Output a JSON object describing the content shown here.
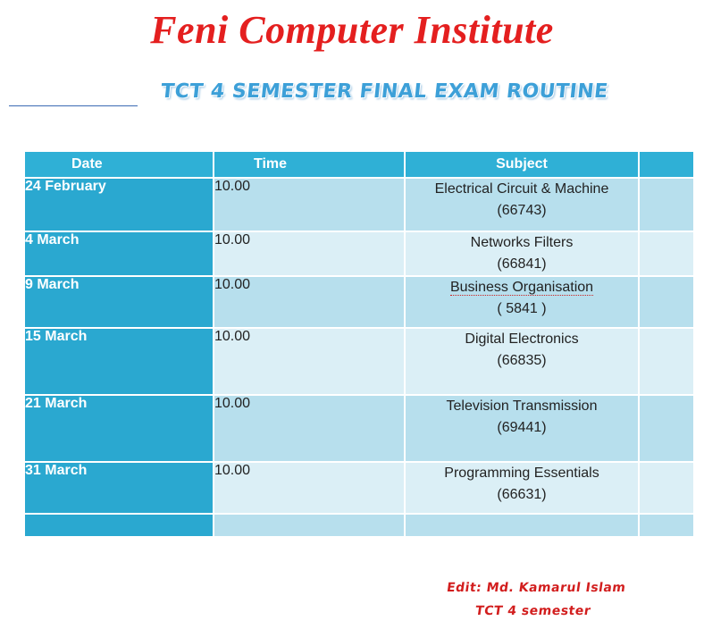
{
  "header": {
    "title": "Feni Computer Institute",
    "subtitle": "TCT 4 SEMESTER FINAL EXAM ROUTINE"
  },
  "table": {
    "columns": [
      "Date",
      "Time",
      "Subject"
    ],
    "rows": [
      {
        "date": "24 February",
        "time": "10.00",
        "subject": "Electrical Circuit & Machine",
        "code": "(66743)"
      },
      {
        "date": "4 March",
        "time": "10.00",
        "subject": "Networks  Filters",
        "code": "(66841)"
      },
      {
        "date": "9 March",
        "time": "10.00",
        "subject": "Business  Organisation",
        "code": "( 5841 )"
      },
      {
        "date": "15 March",
        "time": "10.00",
        "subject": "Digital  Electronics",
        "code": "(66835)"
      },
      {
        "date": "21 March",
        "time": "10.00",
        "subject": "Television Transmission",
        "code": "(69441)"
      },
      {
        "date": "31 March",
        "time": "10.00",
        "subject": "Programming  Essentials",
        "code": "(66631)"
      }
    ]
  },
  "signature": {
    "line1": "Edit: Md. Kamarul  Islam",
    "line2": "TCT 4 semester"
  },
  "colors": {
    "title": "#e41f1f",
    "subtitle": "#3da0d8",
    "header_bg": "#2fb0d6",
    "date_bg": "#2aa8d0",
    "row_light": "#dbeff6",
    "row_mid": "#b7dfed",
    "signature": "#d21e1e"
  }
}
